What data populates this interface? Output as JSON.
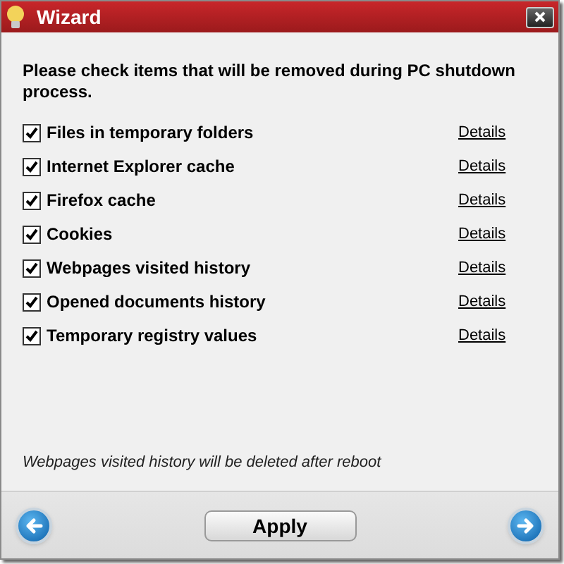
{
  "window": {
    "title": "Wizard"
  },
  "instruction": "Please check items that will be removed during PC shutdown process.",
  "items": [
    {
      "label": "Files in temporary folders",
      "checked": true,
      "link": "Details"
    },
    {
      "label": "Internet Explorer cache",
      "checked": true,
      "link": "Details"
    },
    {
      "label": "Firefox cache",
      "checked": true,
      "link": "Details"
    },
    {
      "label": "Cookies",
      "checked": true,
      "link": "Details"
    },
    {
      "label": "Webpages visited history",
      "checked": true,
      "link": "Details"
    },
    {
      "label": "Opened documents history",
      "checked": true,
      "link": "Details"
    },
    {
      "label": "Temporary registry values",
      "checked": true,
      "link": "Details"
    }
  ],
  "note": "Webpages visited history will be deleted after reboot",
  "buttons": {
    "apply": "Apply"
  }
}
